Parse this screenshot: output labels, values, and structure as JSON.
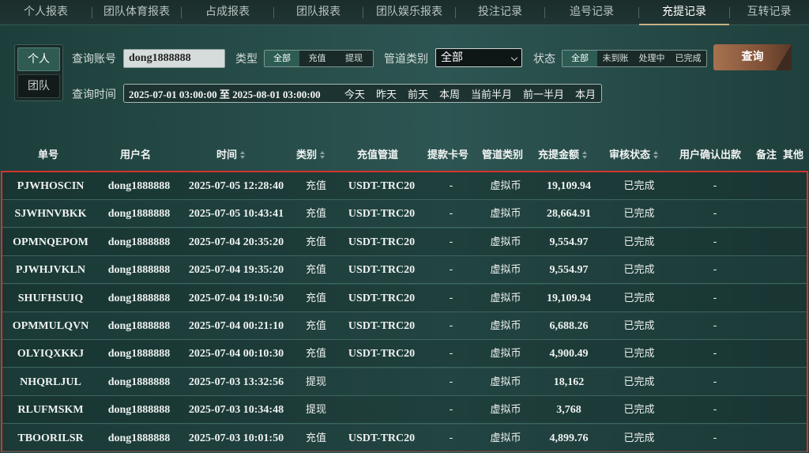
{
  "tabs": [
    {
      "label": "个人报表",
      "active": false
    },
    {
      "label": "团队体育报表",
      "active": false
    },
    {
      "label": "占成报表",
      "active": false
    },
    {
      "label": "团队报表",
      "active": false
    },
    {
      "label": "团队娱乐报表",
      "active": false
    },
    {
      "label": "投注记录",
      "active": false
    },
    {
      "label": "追号记录",
      "active": false
    },
    {
      "label": "充提记录",
      "active": true
    },
    {
      "label": "互转记录",
      "active": false
    }
  ],
  "mode": {
    "personal": "个人",
    "team": "团队"
  },
  "filters": {
    "account_label": "查询账号",
    "account_value": "dong1888888",
    "type_label": "类型",
    "type_options": [
      "全部",
      "充值",
      "提现"
    ],
    "channel_label": "管道类别",
    "channel_value": "全部",
    "status_label": "状态",
    "status_options": [
      "全部",
      "未到账",
      "处理中",
      "已完成"
    ],
    "query_button": "查询",
    "time_label": "查询时间",
    "time_range": "2025-07-01 03:00:00 至 2025-08-01 03:00:00",
    "quick_ranges": [
      "今天",
      "昨天",
      "前天",
      "本周",
      "当前半月",
      "前一半月",
      "本月"
    ]
  },
  "table": {
    "headers": [
      "单号",
      "用户名",
      "时间",
      "类别",
      "充值管道",
      "提款卡号",
      "管道类别",
      "充提金额",
      "审核状态",
      "用户确认出款",
      "备注",
      "其他"
    ],
    "rows": [
      [
        "PJWHOSCIN",
        "dong1888888",
        "2025-07-05 12:28:40",
        "充值",
        "USDT-TRC20",
        "-",
        "虚拟币",
        "19,109.94",
        "已完成",
        "-"
      ],
      [
        "SJWHNVBKK",
        "dong1888888",
        "2025-07-05 10:43:41",
        "充值",
        "USDT-TRC20",
        "-",
        "虚拟币",
        "28,664.91",
        "已完成",
        "-"
      ],
      [
        "OPMNQEPOM",
        "dong1888888",
        "2025-07-04 20:35:20",
        "充值",
        "USDT-TRC20",
        "-",
        "虚拟币",
        "9,554.97",
        "已完成",
        "-"
      ],
      [
        "PJWHJVKLN",
        "dong1888888",
        "2025-07-04 19:35:20",
        "充值",
        "USDT-TRC20",
        "-",
        "虚拟币",
        "9,554.97",
        "已完成",
        "-"
      ],
      [
        "SHUFHSUIQ",
        "dong1888888",
        "2025-07-04 19:10:50",
        "充值",
        "USDT-TRC20",
        "-",
        "虚拟币",
        "19,109.94",
        "已完成",
        "-"
      ],
      [
        "OPMMULQVN",
        "dong1888888",
        "2025-07-04 00:21:10",
        "充值",
        "USDT-TRC20",
        "-",
        "虚拟币",
        "6,688.26",
        "已完成",
        "-"
      ],
      [
        "OLYIQXKKJ",
        "dong1888888",
        "2025-07-04 00:10:30",
        "充值",
        "USDT-TRC20",
        "-",
        "虚拟币",
        "4,900.49",
        "已完成",
        "-"
      ],
      [
        "NHQRLJUL",
        "dong1888888",
        "2025-07-03 13:32:56",
        "提现",
        "",
        "-",
        "虚拟币",
        "18,162",
        "已完成",
        "-"
      ],
      [
        "RLUFMSKM",
        "dong1888888",
        "2025-07-03 10:34:48",
        "提现",
        "",
        "-",
        "虚拟币",
        "3,768",
        "已完成",
        "-"
      ],
      [
        "TBOORILSR",
        "dong1888888",
        "2025-07-03 10:01:50",
        "充值",
        "USDT-TRC20",
        "-",
        "虚拟币",
        "4,899.76",
        "已完成",
        "-"
      ]
    ]
  },
  "colors": {
    "highlight_border": "#d3342c",
    "active_tab_underline": "#c7b185",
    "query_button": "#a77250"
  }
}
